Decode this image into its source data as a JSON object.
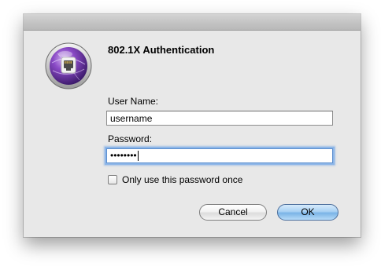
{
  "dialog": {
    "title": "802.1X Authentication",
    "icon": "network-lock-icon"
  },
  "user_name": {
    "label": "User Name:",
    "value": "username"
  },
  "password": {
    "label": "Password:",
    "value": "••••••••"
  },
  "remember": {
    "label": "Only use this password once",
    "checked": false
  },
  "buttons": {
    "cancel_label": "Cancel",
    "ok_label": "OK"
  },
  "colors": {
    "dialog_bg": "#e8e8e8",
    "icon_purple": "#7b3fb8",
    "focus_ring": "#8db6e8",
    "ok_button_blue": "#7ab3e6"
  }
}
